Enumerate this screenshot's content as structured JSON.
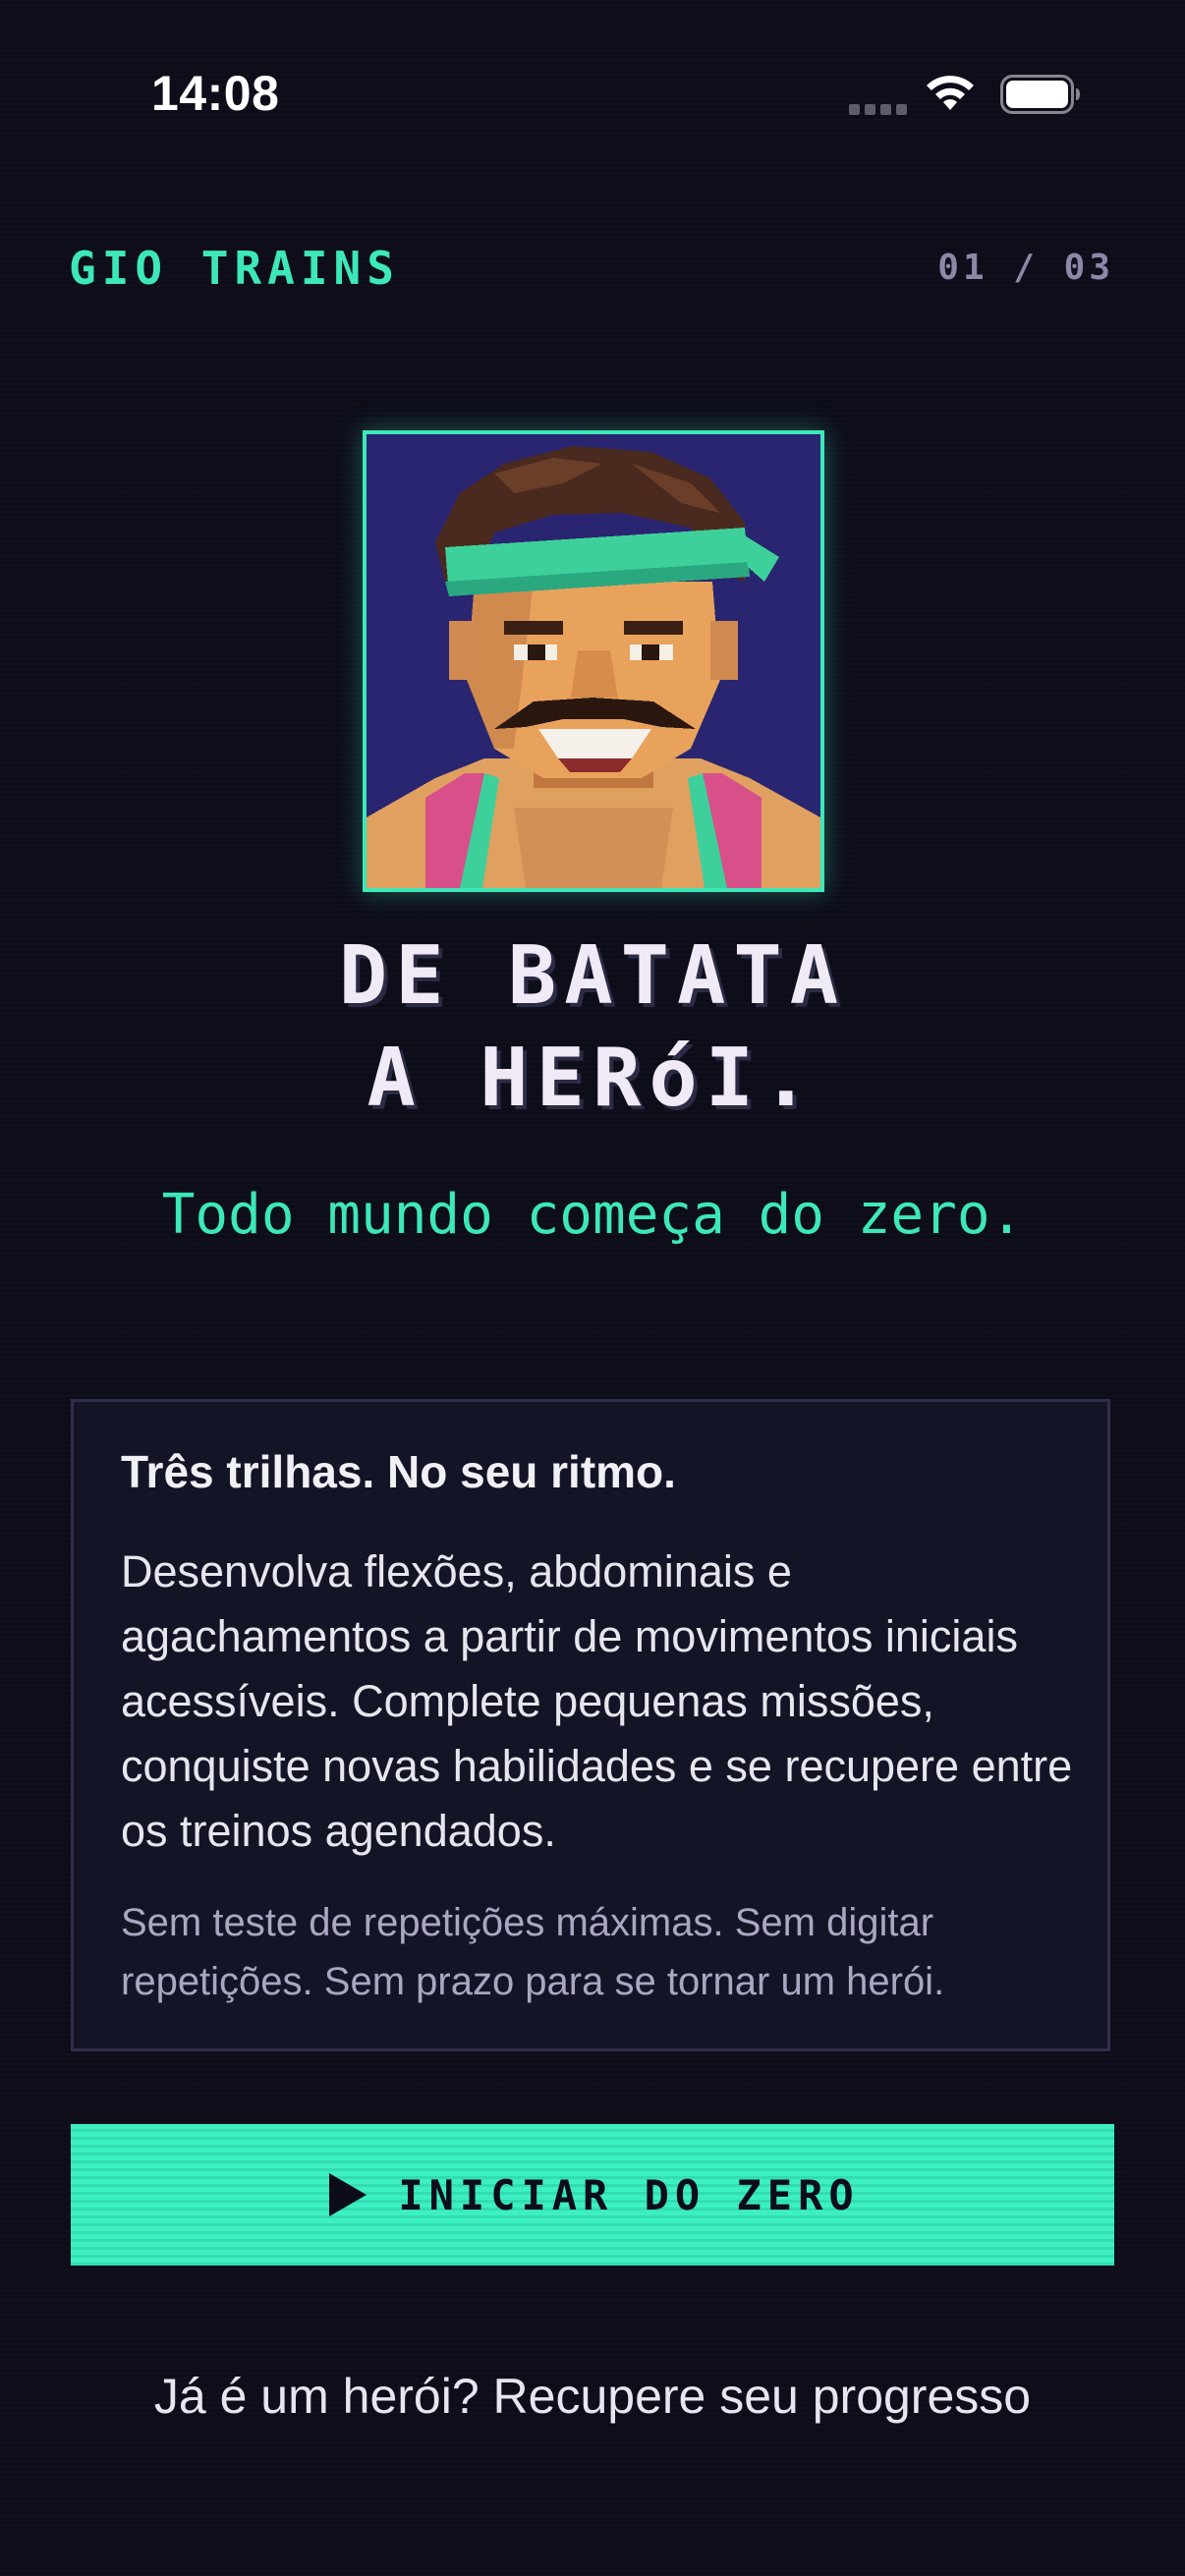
{
  "status_bar": {
    "time": "14:08"
  },
  "header": {
    "brand": "GIO TRAINS",
    "step_counter": "01 / 03"
  },
  "hero": {
    "headline_line1": "DE BATATA",
    "headline_line2": "A HERóI.",
    "tagline": "Todo mundo começa do zero."
  },
  "card": {
    "title": "Três trilhas. No seu ritmo.",
    "body": "Desenvolva flexões, abdominais e agachamentos a partir de movimentos iniciais acessíveis. Complete pequenas missões, conquiste novas habilidades e se recupere entre os treinos agendados.",
    "note": "Sem teste de repetições máximas. Sem digitar repetições. Sem prazo para se tornar um herói."
  },
  "cta": {
    "label": "INICIAR DO ZERO",
    "icon": "play-icon"
  },
  "footer": {
    "restore_link": "Já é um herói? Recupere seu progresso"
  },
  "colors": {
    "background": "#0d0d1a",
    "accent": "#3de8b8",
    "card_background": "#141427",
    "card_border": "#2f2e4c",
    "muted_text": "#8a89a8",
    "portrait_background": "#2a2570"
  },
  "icons": [
    "cellular-signal-icon",
    "wifi-icon",
    "battery-icon",
    "play-icon"
  ]
}
